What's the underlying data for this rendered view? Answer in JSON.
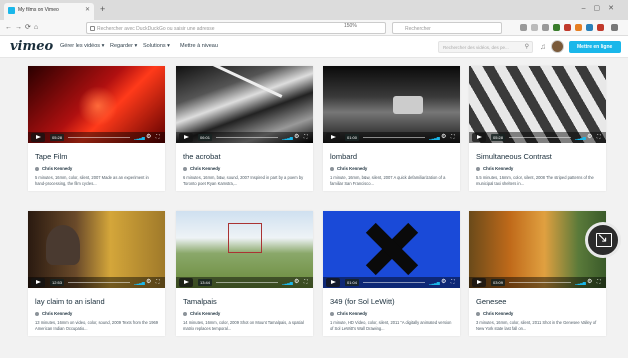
{
  "browser": {
    "tab_title": "My films on Vimeo",
    "address_placeholder": "Rechercher avec DuckDuckGo ou saisir une adresse",
    "zoom": "150%",
    "search_placeholder": "Rechercher"
  },
  "vimeo": {
    "logo": "vimeo",
    "menu": [
      "Gérer les vidéos ▾",
      "Regarder ▾",
      "Solutions ▾",
      "Mettre à niveau"
    ],
    "search_placeholder": "Rechercher des vidéos, des pe...",
    "upload_label": "Mettre en ligne"
  },
  "videos": [
    {
      "title": "Tape Film",
      "author": "Chris Kennedy",
      "duration": "05:28",
      "desc": "5 minutes, 16mm, color, silent, 2007 Made as an experiment in hand-processing, the film cycles..."
    },
    {
      "title": "the acrobat",
      "author": "Chris Kennedy",
      "duration": "06:01",
      "desc": "6 minutes, 16mm, b&w, sound, 2007 Inspired in part by a poem by Toronto poet Ryan Kamstra,..."
    },
    {
      "title": "lombard",
      "author": "Chris Kennedy",
      "duration": "01:00",
      "desc": "1 minute, 16mm, b&w, silent, 2007 A quick defamiliarization of a familiar San Francisco..."
    },
    {
      "title": "Simultaneous Contrast",
      "author": "Chris Kennedy",
      "duration": "05:28",
      "desc": "5.5 minutes, 16mm, color, silent, 2008 The striped patterns of the municipal taxi shelters in..."
    },
    {
      "title": "lay claim to an island",
      "author": "Chris Kennedy",
      "duration": "12:53",
      "desc": "13 minutes, 16mm on video, color, sound, 2009 Texts from the 1969 American Indian Occupatio..."
    },
    {
      "title": "Tamalpais",
      "author": "Chris Kennedy",
      "duration": "13:44",
      "desc": "14 minutes, 16mm, color, 2009 Shot on Mount Tamalpais, a spatial matrix replaces temporal..."
    },
    {
      "title": "349 (for Sol LeWitt)",
      "author": "Chris Kennedy",
      "duration": "01:04",
      "desc": "1 minute, HD Video, color, silent, 2011 \"A digitally animated version of Sol LeWitt's Wall Drawing..."
    },
    {
      "title": "Genesee",
      "author": "Chris Kennedy",
      "duration": "03:09",
      "desc": "3 minutes, 16mm, color, silent, 2011 Shot in the Genesee Valley of New York state last fall on..."
    }
  ]
}
